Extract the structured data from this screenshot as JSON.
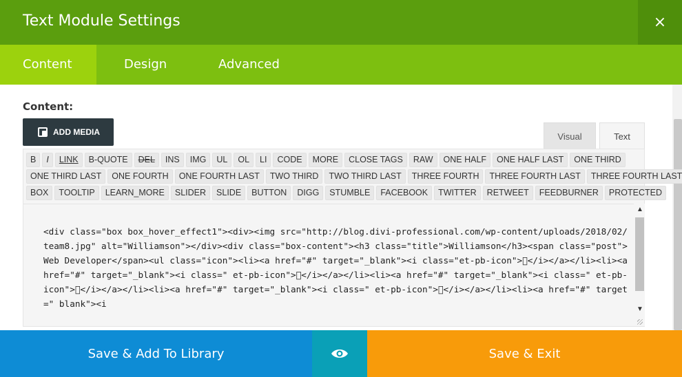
{
  "modal": {
    "title": "Text Module Settings",
    "close_glyph": "×"
  },
  "tabs": [
    {
      "label": "Content",
      "active": true
    },
    {
      "label": "Design",
      "active": false
    },
    {
      "label": "Advanced",
      "active": false
    }
  ],
  "content": {
    "label": "Content:",
    "add_media_label": "ADD MEDIA",
    "mode_tabs": {
      "visual": "Visual",
      "text": "Text",
      "active": "text"
    }
  },
  "quicktags": {
    "row1": [
      "B",
      "I",
      "LINK",
      "B-QUOTE",
      "DEL",
      "INS",
      "IMG",
      "UL",
      "OL",
      "LI",
      "CODE",
      "MORE",
      "CLOSE TAGS",
      "RAW",
      "ONE HALF",
      "ONE HALF LAST",
      "ONE THIRD"
    ],
    "row2": [
      "ONE THIRD LAST",
      "ONE FOURTH",
      "ONE FOURTH LAST",
      "TWO THIRD",
      "TWO THIRD LAST",
      "THREE FOURTH",
      "THREE FOURTH LAST",
      "THREE FOURTH LAST"
    ],
    "row3": [
      "BOX",
      "TOOLTIP",
      "LEARN_MORE",
      "SLIDER",
      "SLIDE",
      "BUTTON",
      "DIGG",
      "STUMBLE",
      "FACEBOOK",
      "TWITTER",
      "RETWEET",
      "FEEDBURNER",
      "PROTECTED"
    ]
  },
  "editor": {
    "code": "<div class=\"box box_hover_effect1\"><div><img src=\"http://blog.divi-professional.com/wp-content/uploads/2018/02/team8.jpg\" alt=\"Williamson\"></div><div class=\"box-content\"><h3 class=\"title\">Williamson</h3><span class=\"post\">Web Developer</span><ul class=\"icon\"><li><a href=\"#\" target=\"_blank\"><i class=\"et-pb-icon\"></i></a></li><li><a href=\"#\" target=\"_blank\"><i class=\" et-pb-icon\"></i></a></li><li><a href=\"#\" target=\"_blank\"><i class=\" et-pb-icon\"></i></a></li><li><a href=\"#\" target=\"_blank\"><i class=\" et-pb-icon\"></i></a></li><li><a href=\"#\" target=\"_blank\"><i"
  },
  "footer": {
    "save_library": "Save & Add To Library",
    "preview_icon": "eye-icon",
    "save_exit": "Save & Exit"
  },
  "colors": {
    "header": "#5b9e0e",
    "tabs": "#7dbf10",
    "tab_active": "#9cd20d",
    "library": "#0e8cd5",
    "preview": "#0aa0b7",
    "exit": "#f89b0a"
  }
}
